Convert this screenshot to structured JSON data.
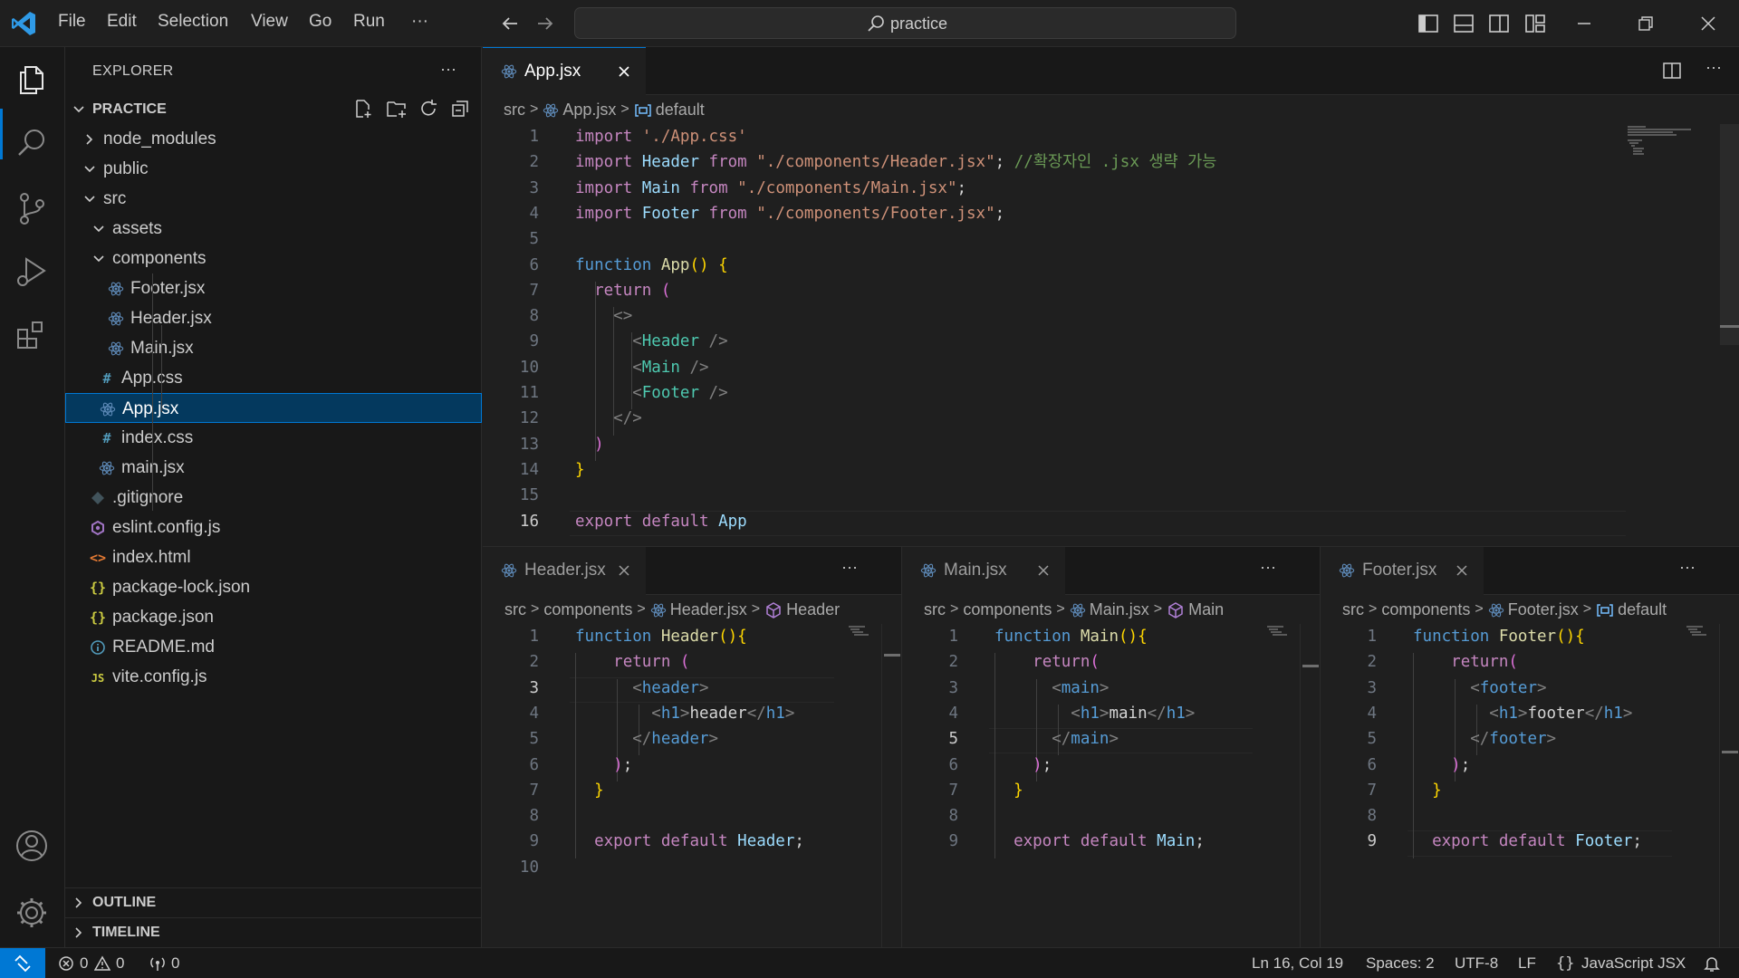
{
  "menu": [
    "File",
    "Edit",
    "Selection",
    "View",
    "Go",
    "Run",
    "···"
  ],
  "search": {
    "text": "practice"
  },
  "sidebar": {
    "title": "EXPLORER",
    "more": "···",
    "root": "PRACTICE",
    "tree": [
      {
        "label": "node_modules",
        "type": "folder-closed",
        "depth": 1
      },
      {
        "label": "public",
        "type": "folder-open",
        "depth": 1
      },
      {
        "label": "src",
        "type": "folder-open",
        "depth": 1
      },
      {
        "label": "assets",
        "type": "folder-open",
        "depth": 2
      },
      {
        "label": "components",
        "type": "folder-open",
        "depth": 2
      },
      {
        "label": "Footer.jsx",
        "type": "react",
        "depth": 3
      },
      {
        "label": "Header.jsx",
        "type": "react",
        "depth": 3
      },
      {
        "label": "Main.jsx",
        "type": "react",
        "depth": 3
      },
      {
        "label": "App.css",
        "type": "css",
        "depth": 2
      },
      {
        "label": "App.jsx",
        "type": "react",
        "depth": 2,
        "selected": true
      },
      {
        "label": "index.css",
        "type": "css",
        "depth": 2
      },
      {
        "label": "main.jsx",
        "type": "react",
        "depth": 2
      },
      {
        "label": ".gitignore",
        "type": "git",
        "depth": 1
      },
      {
        "label": "eslint.config.js",
        "type": "eslint",
        "depth": 1
      },
      {
        "label": "index.html",
        "type": "html",
        "depth": 1
      },
      {
        "label": "package-lock.json",
        "type": "json",
        "depth": 1
      },
      {
        "label": "package.json",
        "type": "json",
        "depth": 1
      },
      {
        "label": "README.md",
        "type": "info",
        "depth": 1
      },
      {
        "label": "vite.config.js",
        "type": "js",
        "depth": 1
      }
    ],
    "outline": "OUTLINE",
    "timeline": "TIMELINE"
  },
  "top_editor": {
    "tab": "App.jsx",
    "breadcrumb": [
      "src",
      "App.jsx",
      "default"
    ],
    "current_line": 16
  },
  "panes": [
    {
      "tab": "Header.jsx",
      "breadcrumb": [
        "src",
        "components",
        "Header.jsx",
        "Header"
      ],
      "current_line": 3
    },
    {
      "tab": "Main.jsx",
      "breadcrumb": [
        "src",
        "components",
        "Main.jsx",
        "Main"
      ],
      "current_line": 5
    },
    {
      "tab": "Footer.jsx",
      "breadcrumb": [
        "src",
        "components",
        "Footer.jsx",
        "default"
      ],
      "current_line": 9
    }
  ],
  "status": {
    "errors": "0",
    "warnings": "0",
    "ports": "0",
    "position": "Ln 16, Col 19",
    "spaces": "Spaces: 2",
    "encoding": "UTF-8",
    "eol": "LF",
    "language": "JavaScript JSX"
  },
  "colors": {
    "accent": "#0078d4",
    "background": "#1f1f1f",
    "sidebar": "#181818"
  }
}
